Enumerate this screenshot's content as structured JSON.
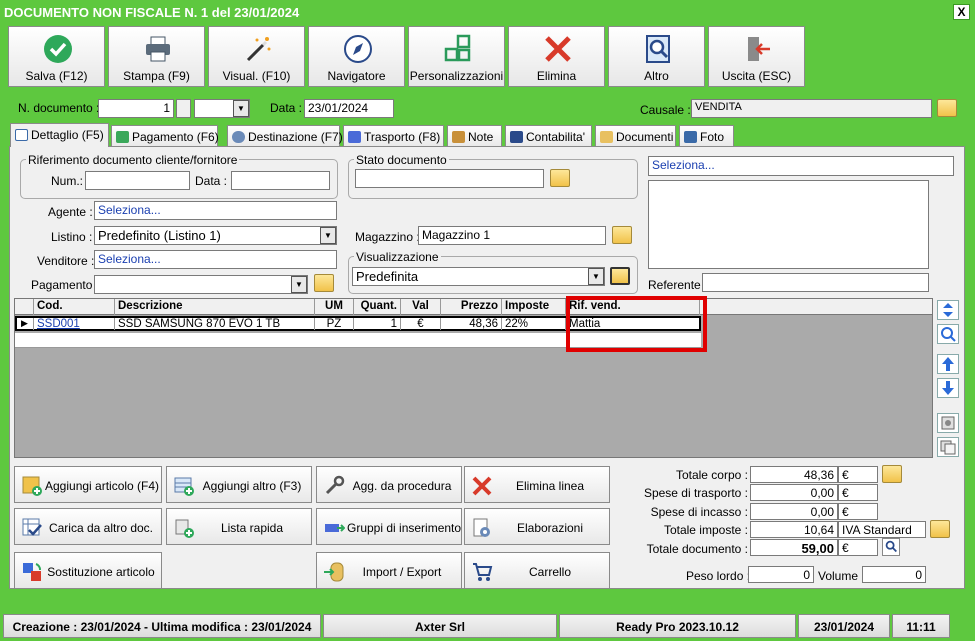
{
  "window": {
    "title": "DOCUMENTO NON FISCALE N. 1 del 23/01/2024",
    "close_label": "X"
  },
  "toolbar": [
    {
      "label": "Salva (F12)",
      "icon": "check-icon"
    },
    {
      "label": "Stampa (F9)",
      "icon": "printer-icon"
    },
    {
      "label": "Visual. (F10)",
      "icon": "magic-wand-icon"
    },
    {
      "label": "Navigatore",
      "icon": "compass-icon"
    },
    {
      "label": "Personalizzazioni",
      "icon": "grid-icon"
    },
    {
      "label": "Elimina",
      "icon": "delete-x-icon"
    },
    {
      "label": "Altro",
      "icon": "search-doc-icon"
    },
    {
      "label": "Uscita (ESC)",
      "icon": "exit-door-icon"
    }
  ],
  "header": {
    "n_doc_label": "N. documento :",
    "n_doc_value": "1",
    "data_label": "Data :",
    "data_value": "23/01/2024",
    "causale_label": "Causale :",
    "causale_value": "VENDITA"
  },
  "tabs": [
    "Dettaglio (F5)",
    "Pagamento (F6)",
    "Destinazione (F7)",
    "Trasporto (F8)",
    "Note",
    "Contabilita'",
    "Documenti",
    "Foto"
  ],
  "riferimento": {
    "title": "Riferimento documento cliente/fornitore",
    "num_label": "Num.:",
    "data_label": "Data :"
  },
  "stato": {
    "title": "Stato documento"
  },
  "fields": {
    "agente_label": "Agente :",
    "agente_value": "Seleziona...",
    "listino_label": "Listino :",
    "listino_value": "Predefinito (Listino 1)",
    "venditore_label": "Venditore :",
    "venditore_value": "Seleziona...",
    "pagamento_label": "Pagamento :",
    "pagamento_value": "",
    "magazzino_label": "Magazzino :",
    "magazzino_value": "Magazzino 1",
    "visualizzazione_title": "Visualizzazione",
    "visualizzazione_value": "Predefinita",
    "cliente_value": "Seleziona...",
    "referente_label": "Referente"
  },
  "grid": {
    "headers": [
      "Cod.",
      "Descrizione",
      "UM",
      "Quant.",
      "Val",
      "Prezzo",
      "Imposte",
      "Rif. vend."
    ],
    "rows": [
      [
        "SSD001",
        "SSD SAMSUNG 870 EVO 1 TB",
        "PZ",
        "1",
        "€",
        "48,36",
        "22%",
        "Mattia"
      ]
    ],
    "highlight_color": "#e00000"
  },
  "buttons": [
    {
      "label": "Aggiungi articolo (F4)",
      "icon": "add-article-icon"
    },
    {
      "label": "Aggiungi altro (F3)",
      "icon": "add-other-icon"
    },
    {
      "label": "Agg. da procedura",
      "icon": "wrench-icon"
    },
    {
      "label": "Elimina linea",
      "icon": "delete-line-icon"
    },
    {
      "label": "Carica da altro doc.",
      "icon": "load-doc-icon"
    },
    {
      "label": "Lista rapida",
      "icon": "quick-list-icon"
    },
    {
      "label": "Gruppi di inserimento",
      "icon": "groups-icon"
    },
    {
      "label": "Elaborazioni",
      "icon": "processing-icon"
    },
    {
      "label": "Sostituzione articolo",
      "icon": "replace-icon"
    },
    {
      "label": "Import / Export",
      "icon": "import-export-icon"
    },
    {
      "label": "Carrello",
      "icon": "cart-icon"
    }
  ],
  "totals": {
    "totale_corpo_label": "Totale corpo :",
    "totale_corpo": "48,36",
    "totale_corpo_cur": "€",
    "spese_trasporto_label": "Spese di trasporto :",
    "spese_trasporto": "0,00",
    "spese_trasporto_cur": "€",
    "spese_incasso_label": "Spese di incasso :",
    "spese_incasso": "0,00",
    "spese_incasso_cur": "€",
    "totale_imposte_label": "Totale imposte :",
    "totale_imposte": "10,64",
    "totale_imposte_desc": "IVA Standard",
    "totale_documento_label": "Totale documento :",
    "totale_documento": "59,00",
    "totale_documento_cur": "€",
    "peso_label": "Peso lordo :",
    "peso": "0",
    "volume_label": "Volume :",
    "volume": "0"
  },
  "status": {
    "creazione": "Creazione : 23/01/2024 - Ultima modifica : 23/01/2024",
    "company": "Axter Srl",
    "version": "Ready Pro 2023.10.12",
    "date": "23/01/2024",
    "time": "11:11"
  }
}
